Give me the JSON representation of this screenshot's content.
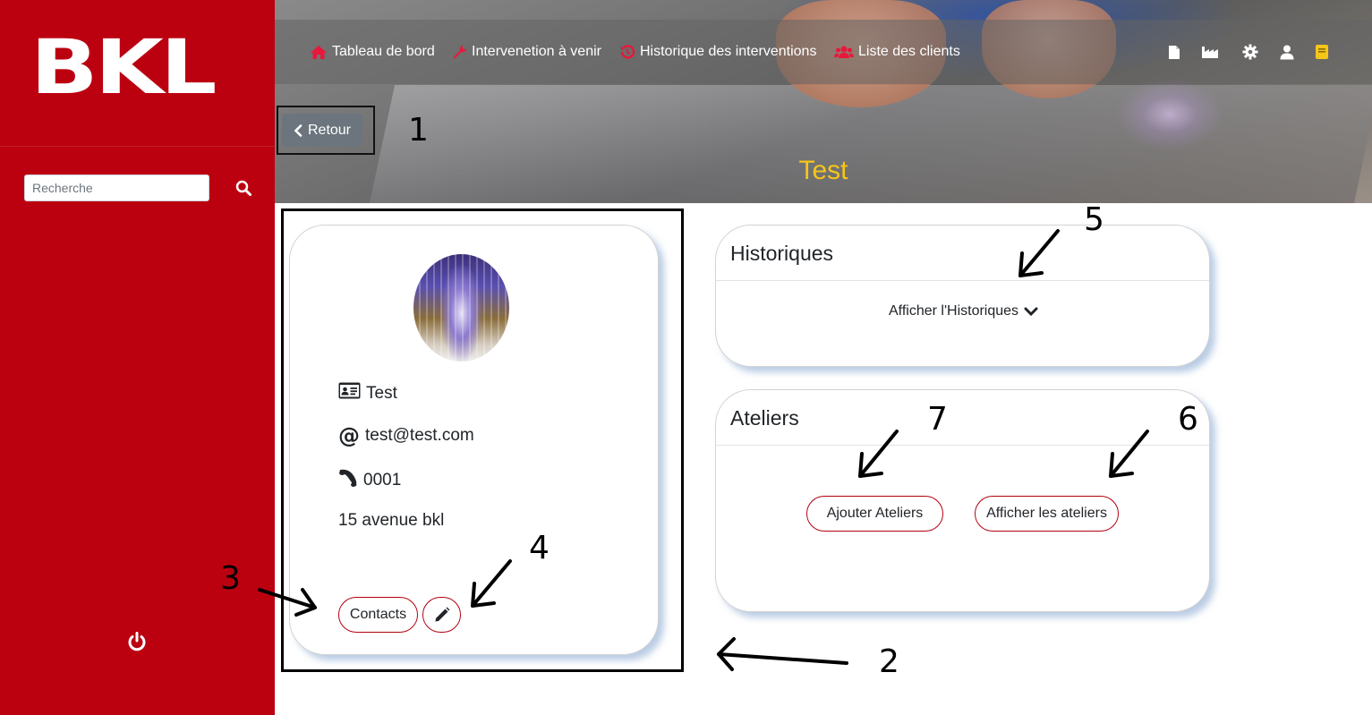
{
  "sidebar": {
    "logo_text": "BKL",
    "search": {
      "placeholder": "Recherche",
      "value": ""
    },
    "icons": {
      "search": "search-icon",
      "logout": "power-icon"
    }
  },
  "nav": {
    "items": [
      {
        "label": "Tableau de bord",
        "icon": "home-icon"
      },
      {
        "label": "Intervenetion à venir",
        "icon": "wrench-icon"
      },
      {
        "label": "Historique des interventions",
        "icon": "history-icon"
      },
      {
        "label": "Liste des clients",
        "icon": "users-icon"
      }
    ],
    "right_icons": [
      "file-icon",
      "industry-icon",
      "gear-icon",
      "user-icon",
      "book-icon"
    ],
    "icon_color": "#e8173b",
    "book_color": "#f5c518"
  },
  "page": {
    "back_label": "Retour",
    "title": "Test",
    "title_color": "#f5c518"
  },
  "profile": {
    "name": "Test",
    "email": "test@test.com",
    "phone": "0001",
    "address": "15 avenue bkl",
    "contacts_label": "Contacts"
  },
  "historiques": {
    "title": "Historiques",
    "toggle_label": "Afficher l'Historiques"
  },
  "ateliers": {
    "title": "Ateliers",
    "add_label": "Ajouter Ateliers",
    "show_label": "Afficher les ateliers"
  },
  "annotations": [
    "1",
    "2",
    "3",
    "4",
    "5",
    "6",
    "7"
  ],
  "colors": {
    "brand_red": "#bb0010",
    "accent_border": "#b3000f",
    "back_button": "#6c757d"
  }
}
